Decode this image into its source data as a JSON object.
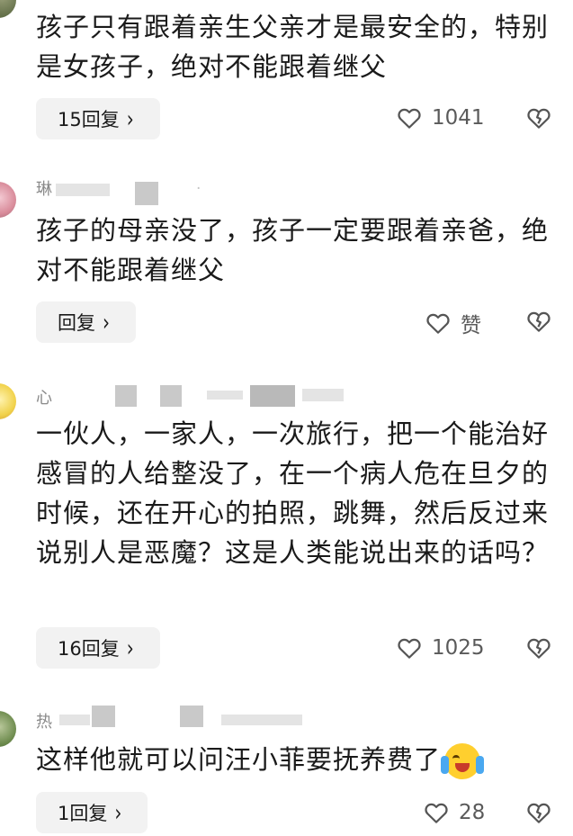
{
  "comments": [
    {
      "text": "孩子只有跟着亲生父亲才是最安全的，特别是女孩子，绝对不能跟着继父",
      "reply_label": "15回复",
      "likes": "1041"
    },
    {
      "username": "琳",
      "text": "孩子的母亲没了，孩子一定要跟着亲爸，绝对不能跟着继父",
      "reply_label": "回复",
      "likes": "赞"
    },
    {
      "username": "心",
      "text": "一伙人，一家人，一次旅行，把一个能治好感冒的人给整没了，在一个病人危在旦夕的时候，还在开心的拍照，跳舞，然后反过来说别人是恶魔？这是人类能说出来的话吗？",
      "reply_label": "16回复",
      "likes": "1025"
    },
    {
      "username": "热",
      "text": "这样他就可以问汪小菲要抚养费了",
      "reply_label": "1回复",
      "likes": "28"
    }
  ],
  "icons": {
    "like": "heart-outline-icon",
    "dislike": "broken-heart-icon",
    "chevron": "chevron-right-icon",
    "emoji": "crying-laughing-emoji"
  },
  "colors": {
    "reply_bg": "#f2f2f2",
    "meta_gray": "#8a8a8a"
  }
}
